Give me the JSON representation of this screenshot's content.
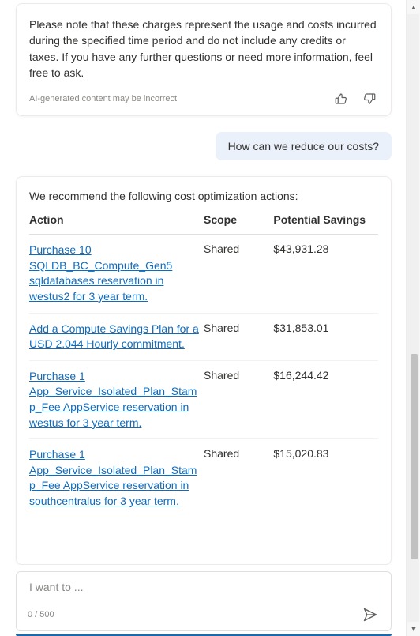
{
  "assistant_card": {
    "note": "Please note that these charges represent the usage and costs incurred during the specified time period and do not include any credits or taxes. If you have any further questions or need more information, feel free to ask.",
    "disclaimer": "AI-generated content may be incorrect"
  },
  "user_message": "How can we reduce our costs?",
  "recommendations": {
    "intro": "We recommend the following cost optimization actions:",
    "headers": {
      "action": "Action",
      "scope": "Scope",
      "savings": "Potential Savings"
    },
    "rows": [
      {
        "action": "Purchase 10 SQLDB_BC_Compute_Gen5 sqldatabases reservation in westus2 for 3 year term.",
        "scope": "Shared",
        "savings": "$43,931.28"
      },
      {
        "action": "Add a Compute Savings Plan for a USD 2.044 Hourly commitment.",
        "scope": "Shared",
        "savings": "$31,853.01"
      },
      {
        "action": "Purchase 1 App_Service_Isolated_Plan_Stamp_Fee AppService reservation in westus for 3 year term.",
        "scope": "Shared",
        "savings": "$16,244.42"
      },
      {
        "action": "Purchase 1 App_Service_Isolated_Plan_Stamp_Fee AppService reservation in southcentralus for 3 year term.",
        "scope": "Shared",
        "savings": "$15,020.83"
      }
    ]
  },
  "input": {
    "placeholder": "I want to ...",
    "char_count": "0 / 500"
  }
}
